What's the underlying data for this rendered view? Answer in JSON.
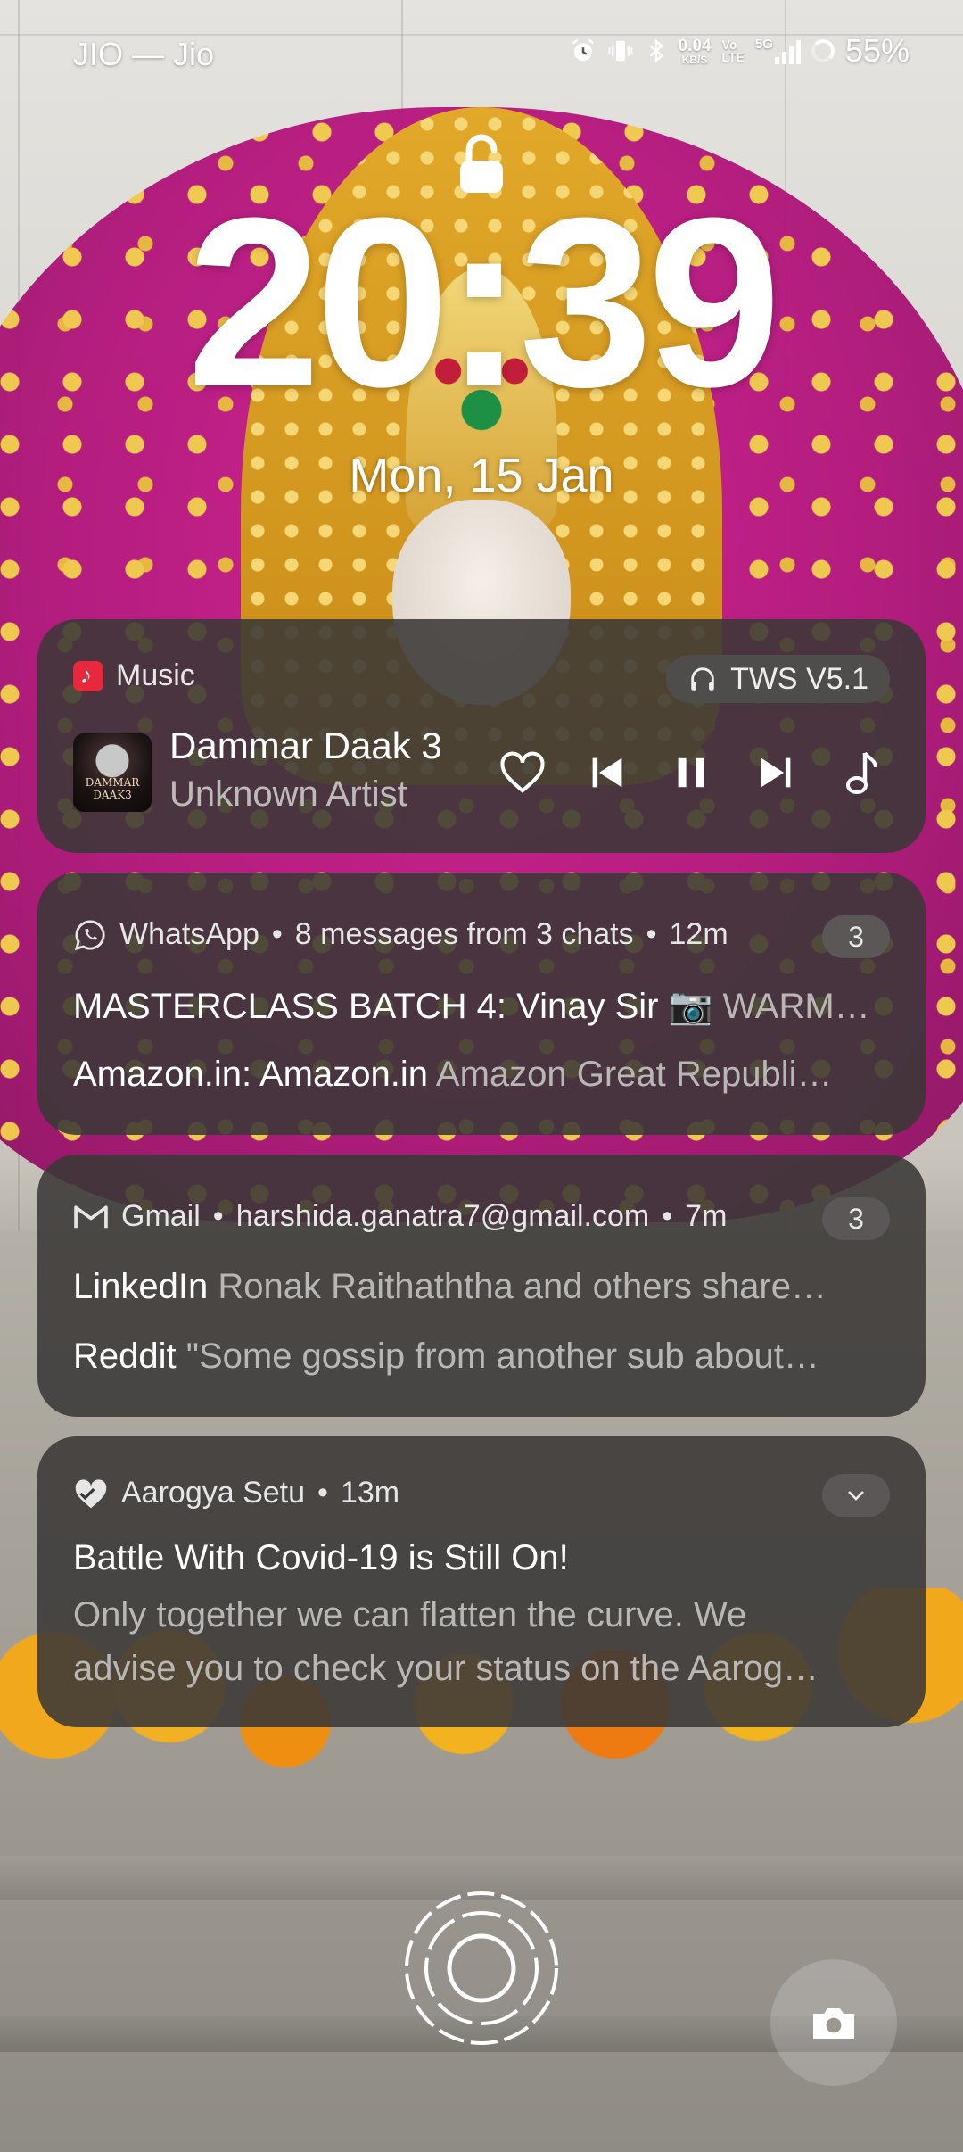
{
  "status_bar": {
    "carrier": "JIO — Jio",
    "net_speed_value": "0.04",
    "net_speed_unit": "KB/S",
    "volte_top": "Vo",
    "volte_bottom": "LTE",
    "network_type": "5G",
    "battery_percent": "55%",
    "icons": [
      "alarm-icon",
      "vibrate-icon",
      "bluetooth-icon",
      "signal-icon",
      "battery-icon"
    ]
  },
  "lockscreen": {
    "time": "20:39",
    "date": "Mon, 15 Jan"
  },
  "music": {
    "app_name": "Music",
    "output_device": "TWS V5.1",
    "album_art_text": "DAMMAR DAAK3",
    "title": "Dammar Daak 3",
    "artist": "Unknown Artist",
    "controls": [
      "favorite",
      "previous",
      "pause",
      "next",
      "music-note"
    ]
  },
  "notifications": [
    {
      "app": "WhatsApp",
      "summary": "8 messages from 3 chats",
      "time": "12m",
      "count": "3",
      "lines": [
        {
          "sender": "MASTERCLASS BATCH 4: Vinay Sir",
          "text": "📷 WARM…"
        },
        {
          "sender": "Amazon.in: Amazon.in",
          "text": "Amazon Great Republi…"
        }
      ]
    },
    {
      "app": "Gmail",
      "summary": "harshida.ganatra7@gmail.com",
      "time": "7m",
      "count": "3",
      "lines": [
        {
          "sender": "LinkedIn",
          "text": "Ronak Raithaththa and others share…"
        },
        {
          "sender": "Reddit",
          "text": "\"Some gossip from another sub about…"
        }
      ]
    },
    {
      "app": "Aarogya Setu",
      "time": "13m",
      "title": "Battle With Covid-19 is Still On!",
      "body_line1": "Only together we can flatten the curve. We",
      "body_line2": "advise you to check your status on the Aarog…"
    }
  ],
  "bottom": {
    "fingerprint": "fingerprint-icon",
    "camera": "camera-icon"
  },
  "colors": {
    "card_bg": "#3a3837",
    "pill_bg": "#5a5756",
    "music_accent": "#e8283c"
  }
}
